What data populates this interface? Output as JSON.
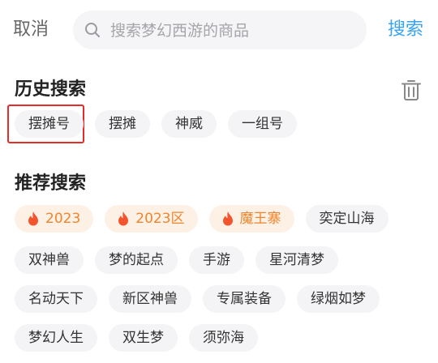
{
  "header": {
    "cancel_label": "取消",
    "search_placeholder": "搜索梦幻西游的商品",
    "search_label": "搜索"
  },
  "history": {
    "title": "历史搜索",
    "items": [
      "摆摊号",
      "摆摊",
      "神威",
      "一组号"
    ]
  },
  "recommended": {
    "title": "推荐搜索",
    "hot_items": [
      "2023",
      "2023区",
      "魔王寨"
    ],
    "row1_rest": [
      "奕定山海"
    ],
    "row2": [
      "双神兽",
      "梦的起点",
      "手游",
      "星河清梦"
    ],
    "row3": [
      "名动天下",
      "新区神兽",
      "专属装备",
      "绿烟如梦"
    ],
    "row4": [
      "梦幻人生",
      "双生梦",
      "须弥海"
    ]
  },
  "colors": {
    "accent": "#3aa3ee",
    "hot_text": "#f0852d",
    "hot_bg": "#fdf0e4",
    "selection_border": "#e62b2b"
  },
  "icons": {
    "search": "search-icon",
    "trash": "trash-icon",
    "hot": "flame-icon"
  }
}
